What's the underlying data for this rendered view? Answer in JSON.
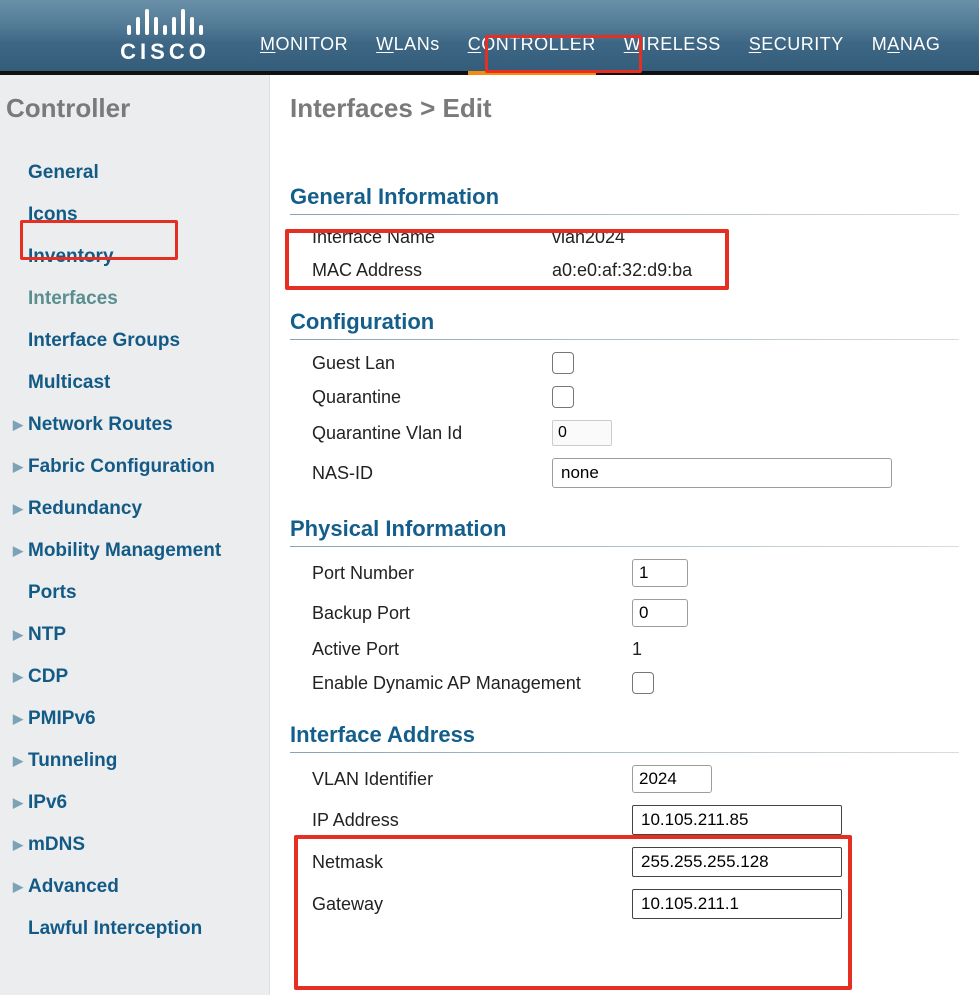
{
  "topnav": [
    {
      "key": "M",
      "rest": "ONITOR"
    },
    {
      "key": "W",
      "rest": "LANs"
    },
    {
      "key": "C",
      "rest": "ONTROLLER"
    },
    {
      "key": "W",
      "rest": "IRELESS"
    },
    {
      "key": "S",
      "rest": "ECURITY"
    },
    {
      "key": "A",
      "prefix": "M",
      "rest": "NAG"
    }
  ],
  "topnav_active": 2,
  "logo_text": "CISCO",
  "sidebar": {
    "title": "Controller",
    "items": [
      {
        "label": "General",
        "arrow": false
      },
      {
        "label": "Icons",
        "arrow": false
      },
      {
        "label": "Inventory",
        "arrow": false
      },
      {
        "label": "Interfaces",
        "arrow": false,
        "active": true
      },
      {
        "label": "Interface Groups",
        "arrow": false
      },
      {
        "label": "Multicast",
        "arrow": false
      },
      {
        "label": "Network Routes",
        "arrow": true
      },
      {
        "label": "Fabric Configuration",
        "arrow": true
      },
      {
        "label": "Redundancy",
        "arrow": true
      },
      {
        "label": "Mobility Management",
        "arrow": true
      },
      {
        "label": "Ports",
        "arrow": false
      },
      {
        "label": "NTP",
        "arrow": true
      },
      {
        "label": "CDP",
        "arrow": true
      },
      {
        "label": "PMIPv6",
        "arrow": true
      },
      {
        "label": "Tunneling",
        "arrow": true
      },
      {
        "label": "IPv6",
        "arrow": true
      },
      {
        "label": "mDNS",
        "arrow": true
      },
      {
        "label": "Advanced",
        "arrow": true
      },
      {
        "label": "Lawful Interception",
        "arrow": false
      }
    ]
  },
  "page": {
    "title": "Interfaces > Edit",
    "general": {
      "heading": "General Information",
      "iface_label": "Interface Name",
      "iface_value": "vlan2024",
      "mac_label": "MAC Address",
      "mac_value": "a0:e0:af:32:d9:ba"
    },
    "config": {
      "heading": "Configuration",
      "guest_label": "Guest Lan",
      "quarantine_label": "Quarantine",
      "qvlan_label": "Quarantine Vlan Id",
      "qvlan_value": "0",
      "nas_label": "NAS-ID",
      "nas_value": "none"
    },
    "physical": {
      "heading": "Physical Information",
      "port_label": "Port Number",
      "port_value": "1",
      "backup_label": "Backup Port",
      "backup_value": "0",
      "active_label": "Active Port",
      "active_value": "1",
      "dyn_label": "Enable Dynamic AP Management"
    },
    "address": {
      "heading": "Interface Address",
      "vlan_label": "VLAN Identifier",
      "vlan_value": "2024",
      "ip_label": "IP Address",
      "ip_value": "10.105.211.85",
      "mask_label": "Netmask",
      "mask_value": "255.255.255.128",
      "gw_label": "Gateway",
      "gw_value": "10.105.211.1"
    }
  }
}
